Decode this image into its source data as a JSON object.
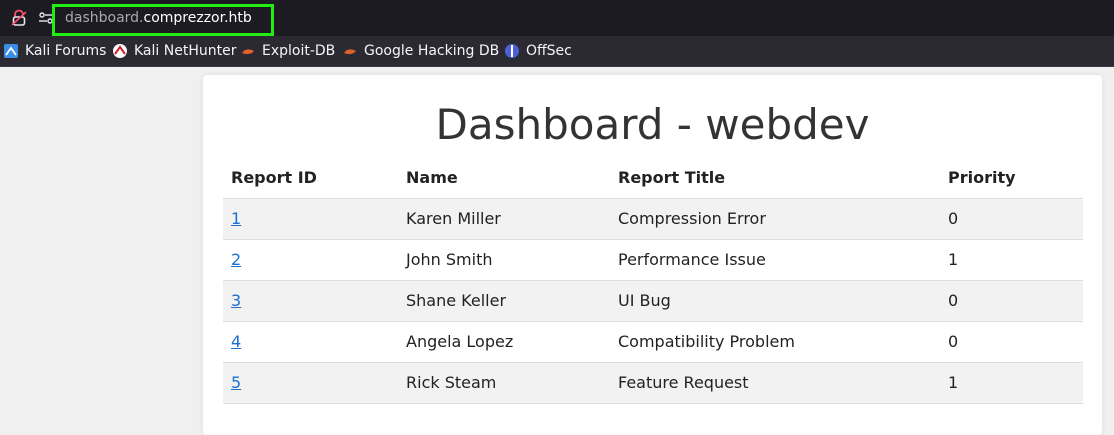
{
  "browser": {
    "url_subdomain": "dashboard.",
    "url_domain": "comprezzor.htb",
    "highlight_color": "#22ee11",
    "bookmarks": [
      {
        "label": "Kali Forums",
        "icon": "kali-forums-icon"
      },
      {
        "label": "Kali NetHunter",
        "icon": "kali-nethunter-icon"
      },
      {
        "label": "Exploit-DB",
        "icon": "exploit-db-icon"
      },
      {
        "label": "Google Hacking DB",
        "icon": "google-hacking-db-icon"
      },
      {
        "label": "OffSec",
        "icon": "offsec-icon"
      }
    ]
  },
  "page": {
    "title": "Dashboard - webdev",
    "table": {
      "headers": [
        "Report ID",
        "Name",
        "Report Title",
        "Priority"
      ],
      "rows": [
        {
          "id": "1",
          "name": "Karen Miller",
          "title": "Compression Error",
          "priority": "0"
        },
        {
          "id": "2",
          "name": "John Smith",
          "title": "Performance Issue",
          "priority": "1"
        },
        {
          "id": "3",
          "name": "Shane Keller",
          "title": "UI Bug",
          "priority": "0"
        },
        {
          "id": "4",
          "name": "Angela Lopez",
          "title": "Compatibility Problem",
          "priority": "0"
        },
        {
          "id": "5",
          "name": "Rick Steam",
          "title": "Feature Request",
          "priority": "1"
        }
      ]
    }
  }
}
